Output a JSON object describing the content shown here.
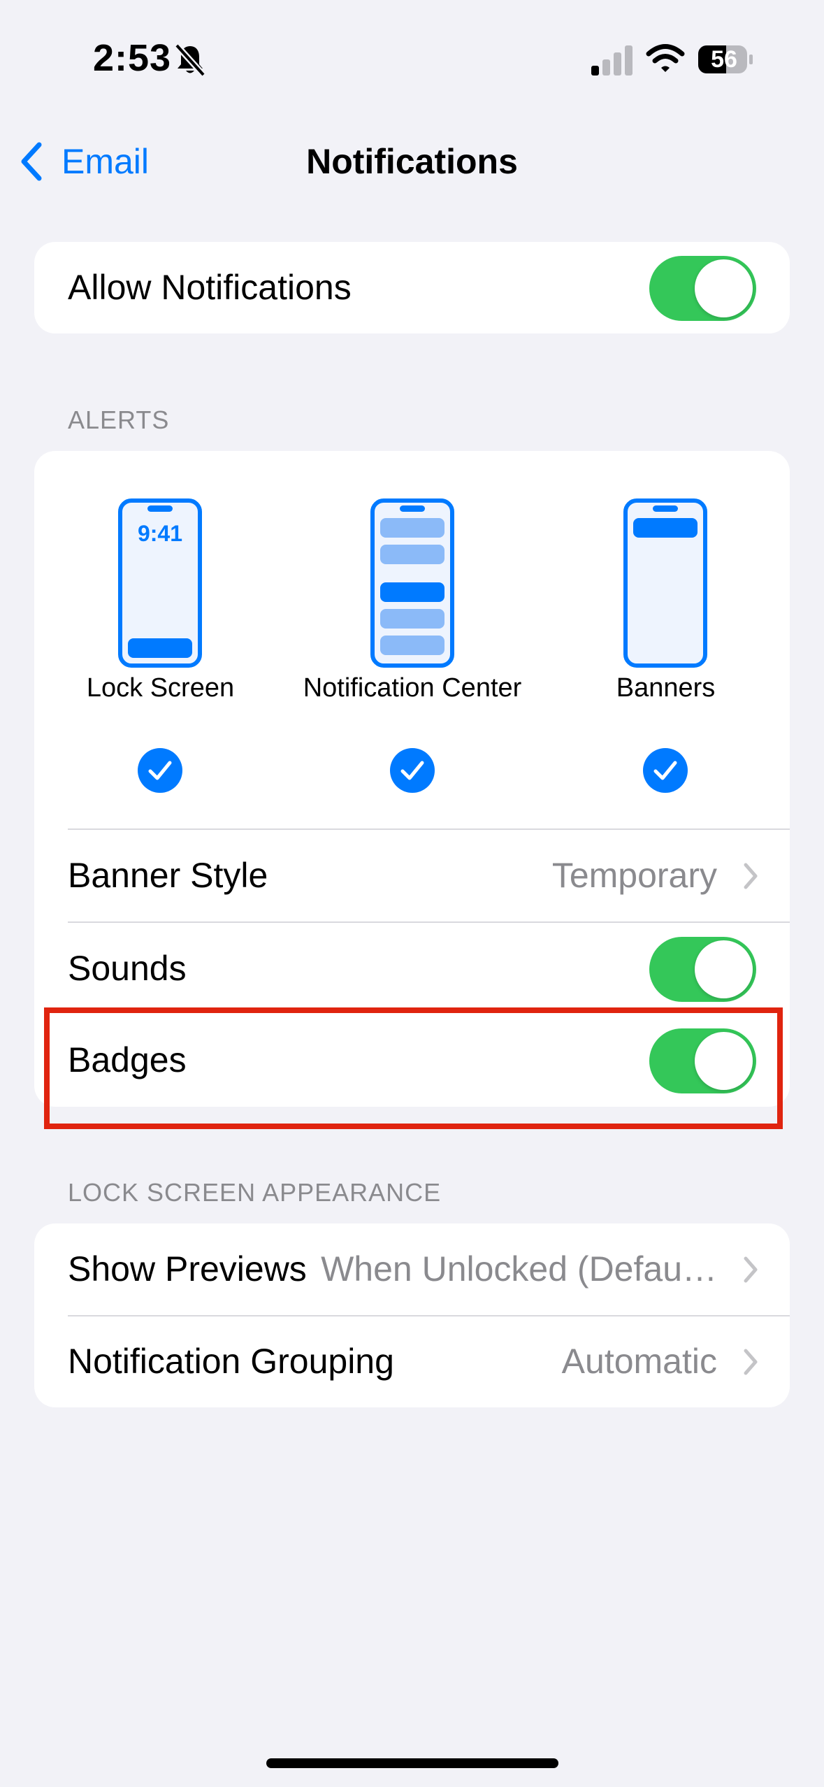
{
  "status_bar": {
    "time": "2:53",
    "battery": "56",
    "icons": [
      "bell-slash-icon",
      "cellular-signal-icon",
      "wifi-icon",
      "battery-icon"
    ]
  },
  "nav": {
    "back_label": "Email",
    "title": "Notifications"
  },
  "allow_notifications": {
    "label": "Allow Notifications",
    "on": true
  },
  "alerts": {
    "header": "ALERTS",
    "styles": [
      {
        "label": "Lock Screen",
        "checked": true,
        "preview_time": "9:41"
      },
      {
        "label": "Notification Center",
        "checked": true
      },
      {
        "label": "Banners",
        "checked": true
      }
    ],
    "banner_style": {
      "label": "Banner Style",
      "value": "Temporary"
    },
    "sounds": {
      "label": "Sounds",
      "on": true
    },
    "badges": {
      "label": "Badges",
      "on": true
    }
  },
  "lock_screen_appearance": {
    "header": "LOCK SCREEN APPEARANCE",
    "show_previews": {
      "label": "Show Previews",
      "value": "When Unlocked (Defau…"
    },
    "notification_grouping": {
      "label": "Notification Grouping",
      "value": "Automatic"
    }
  },
  "colors": {
    "accent": "#007AFF",
    "toggle_on": "#34C759",
    "highlight": "#E0240F",
    "background": "#F2F2F7"
  }
}
